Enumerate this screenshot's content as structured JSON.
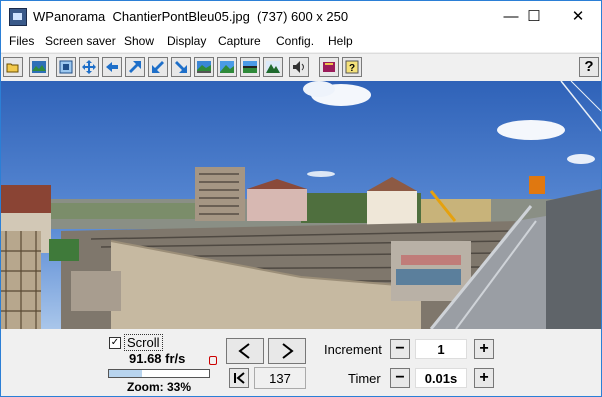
{
  "title": {
    "app_name": "WPanorama",
    "file_name": "ChantierPontBleu05.jpg",
    "image_info": "(737) 600 x 250"
  },
  "window_controls": {
    "minimize": "—",
    "maximize": "☐",
    "close": "✕"
  },
  "menu": [
    "Files",
    "Screen saver",
    "Show",
    "Display",
    "Capture",
    "Config.",
    "Help"
  ],
  "toolbar": {
    "icons": [
      "open-folder-icon",
      "image-icon",
      "fit-window-icon",
      "fullscreen-arrows-icon",
      "arrow-left-icon",
      "arrow-up-right-icon",
      "arrow-down-left-icon",
      "arrow-down-right-icon",
      "landscape-panel-icon",
      "landscape-icon",
      "horizon-icon",
      "mountain-icon",
      "speaker-icon",
      "book-icon",
      "help-contents-icon"
    ],
    "help_label": "?"
  },
  "controls": {
    "scroll_checked": true,
    "scroll_check_mark": "✓",
    "scroll_label": "Scroll",
    "fps": "91.68 fr/s",
    "zoom": "Zoom: 33%",
    "zoom_fraction": 0.33,
    "frame_value": "137",
    "increment_label": "Increment",
    "increment_value": "1",
    "timer_label": "Timer",
    "timer_value": "0.01s",
    "minus": "−",
    "plus": "+"
  }
}
